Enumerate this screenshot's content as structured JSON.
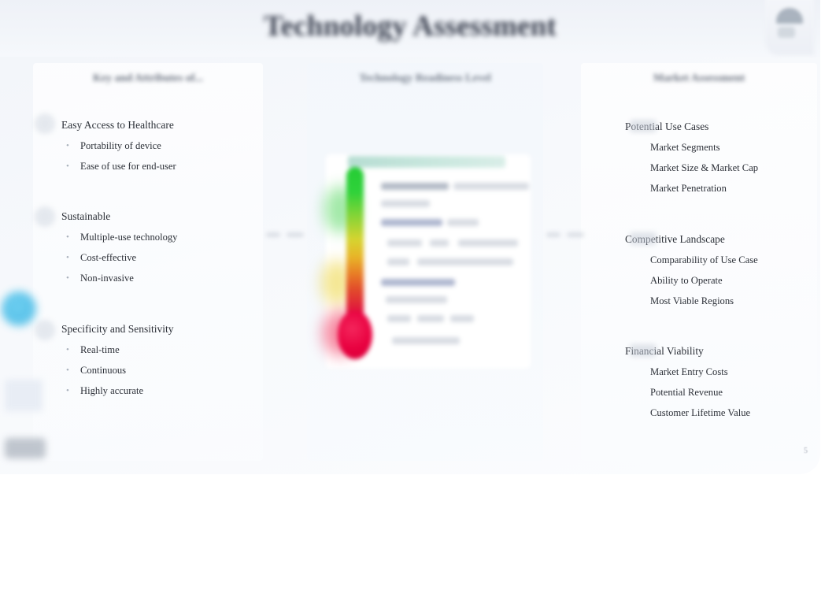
{
  "slide": {
    "title": "Technology Assessment",
    "page_number": "5",
    "background_color": "#f4f7fb",
    "corner_logo_name": "company-logo"
  },
  "columns": [
    {
      "id": "technology-criteria",
      "header": "Key and Attributes of...",
      "groups": [
        {
          "title": "Easy Access to Healthcare",
          "icon": "accessibility-icon",
          "bullets": [
            "Portability of device",
            "Ease of use for end-user"
          ]
        },
        {
          "title": "Sustainable",
          "icon": "sustainability-icon",
          "bullets": [
            "Multiple-use technology",
            "Cost-effective",
            "Non-invasive"
          ]
        },
        {
          "title": "Specificity and Sensitivity",
          "icon": "precision-icon",
          "bullets": [
            "Real-time",
            "Continuous",
            "Highly accurate"
          ]
        }
      ]
    },
    {
      "id": "technology-readiness",
      "header": "Technology Readiness Level",
      "graphic": {
        "name": "thermometer-scale",
        "title_bar_color": "#bfe2d8",
        "gradient_top_color": "#25cc35",
        "gradient_mid_color": "#e8b528",
        "gradient_bottom_color": "#e3004f",
        "legend_rows": 9
      }
    },
    {
      "id": "market-assessment",
      "header": "Market Assessment",
      "groups": [
        {
          "title": "Potential Use Cases",
          "icon": "use-case-icon",
          "subitems": [
            "Market Segments",
            "Market Size & Market Cap",
            "Market Penetration"
          ]
        },
        {
          "title": "Competitive Landscape",
          "icon": "competition-icon",
          "subitems": [
            "Comparability of Use Case",
            "Ability to Operate",
            "Most Viable Regions"
          ]
        },
        {
          "title": "Financial Viability",
          "icon": "finance-icon",
          "subitems": [
            "Market Entry Costs",
            "Potential Revenue",
            "Customer Lifetime Value"
          ]
        }
      ]
    }
  ],
  "decorations": {
    "edge_circle_color": "#3fb9e6",
    "connector_count": 2
  }
}
